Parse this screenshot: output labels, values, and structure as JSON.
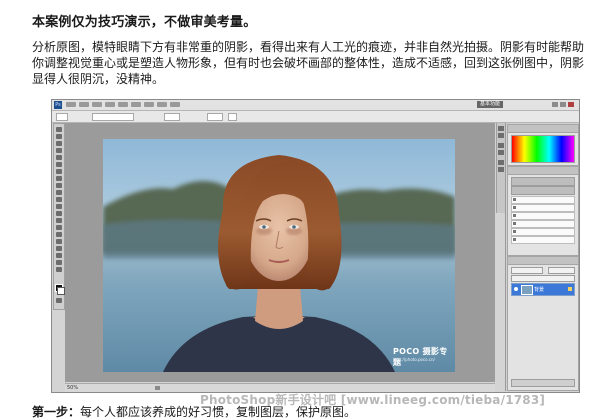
{
  "heading": "本案例仅为技巧演示，不做审美考量。",
  "paragraph": "分析原图，模特眼睛下方有非常重的阴影，看得出来有人工光的痕迹，并非自然光拍摄。阴影有时能帮助你调整视觉重心或是塑造人物形象，但有时也会破坏画部的整体性，造成不适感，回到这张例图中，阴影显得人很阴沉，没精神。",
  "photoshop": {
    "workspace_button": "基本功能",
    "canvas_watermark": {
      "logo": "POCO 摄影专题",
      "url": "http://photo.poco.cn/"
    },
    "status": {
      "zoom": "50%"
    },
    "layer_name": "背景",
    "colors": {
      "selection": "#3c78d8",
      "workspace": "#9b9b9b"
    }
  },
  "site_watermark": "PhotoShop新手设计吧 [www.lineeg.com/tieba/1783]",
  "step": {
    "label": "第一步：",
    "text": "每个人都应该养成的好习惯，复制图层，保护原图。"
  }
}
